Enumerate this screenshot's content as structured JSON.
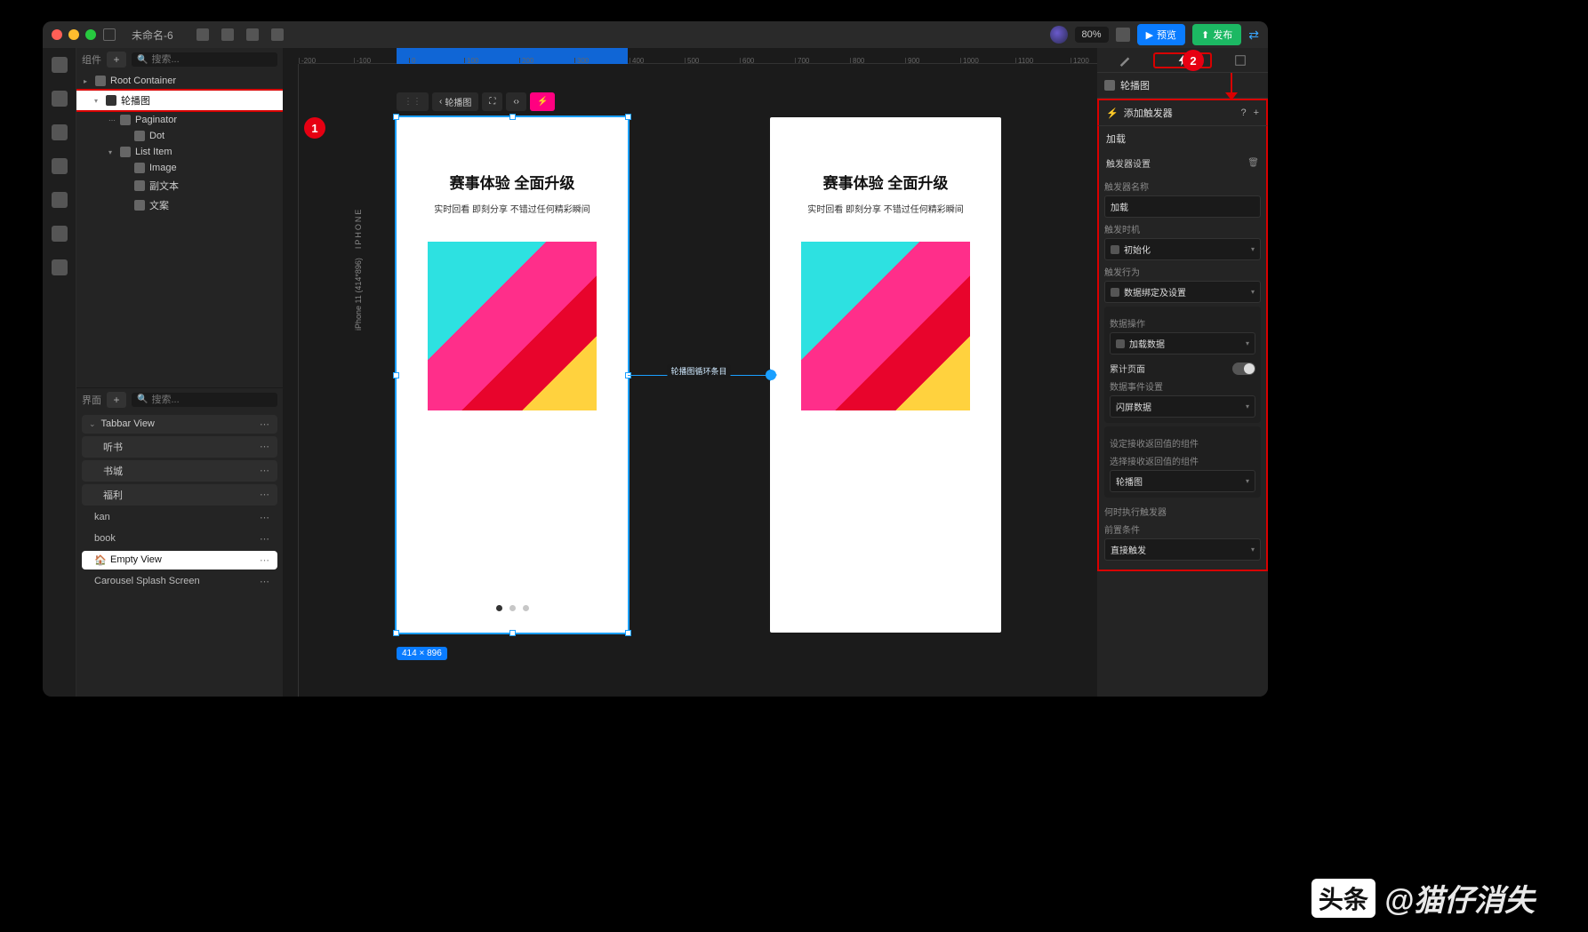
{
  "window": {
    "title": "未命名-6"
  },
  "toolbar": {
    "zoom": "80%",
    "preview": "预览",
    "publish": "发布"
  },
  "panels": {
    "components": {
      "label": "组件",
      "search_ph": "搜索..."
    },
    "pages": {
      "label": "界面",
      "search_ph": "搜索..."
    }
  },
  "tree": [
    {
      "label": "Root Container",
      "indent": 0,
      "chev": "▸"
    },
    {
      "label": "轮播图",
      "indent": 1,
      "chev": "▾",
      "selected": true
    },
    {
      "label": "Paginator",
      "indent": 2,
      "chev": "⋯"
    },
    {
      "label": "Dot",
      "indent": 3
    },
    {
      "label": "List Item",
      "indent": 2,
      "chev": "▾"
    },
    {
      "label": "Image",
      "indent": 3
    },
    {
      "label": "副文本",
      "indent": 3
    },
    {
      "label": "文案",
      "indent": 3
    }
  ],
  "pages": {
    "group": "Tabbar View",
    "subs": [
      "听书",
      "书城",
      "福利"
    ],
    "items": [
      "kan",
      "book",
      "Empty View",
      "Carousel Splash Screen"
    ],
    "selected": "Empty View"
  },
  "canvas": {
    "crumb": "轮播图",
    "device_label": "iPhone 11 (414*896)",
    "device_rot": "IPHONE",
    "artboard": {
      "title": "赛事体验 全面升级",
      "subtitle": "实时回看 即刻分享 不错过任何精彩瞬间"
    },
    "connector_label": "轮播图循环条目",
    "size_badge": "414 × 896",
    "ruler_ticks": [
      "-200",
      "-100",
      "0",
      "100",
      "200",
      "300",
      "400",
      "500",
      "600",
      "700",
      "800",
      "900",
      "1000",
      "1100",
      "1200"
    ]
  },
  "inspector": {
    "component": "轮播图",
    "add_trigger": "添加触发器",
    "triggers": [
      {
        "name": "加载",
        "section_settings": "触发器设置",
        "label_name": "触发器名称",
        "value_name": "加载",
        "label_timing": "触发时机",
        "value_timing": "初始化",
        "label_action": "触发行为",
        "value_action": "数据绑定及设置",
        "sub": {
          "label_op": "数据操作",
          "value_op": "加载数据",
          "label_accum": "累计页面",
          "label_event": "数据事件设置",
          "value_event": "闪屏数据"
        },
        "ret": {
          "label_set": "设定接收返回值的组件",
          "label_pick": "选择接收返回值的组件",
          "value_pick": "轮播图"
        },
        "when": {
          "label_when": "何时执行触发器",
          "label_pre": "前置条件",
          "value_pre": "直接触发"
        }
      }
    ]
  },
  "annotations": {
    "one": "1",
    "two": "2"
  },
  "watermark": {
    "logo": "头条",
    "handle": "@猫仔消失"
  }
}
